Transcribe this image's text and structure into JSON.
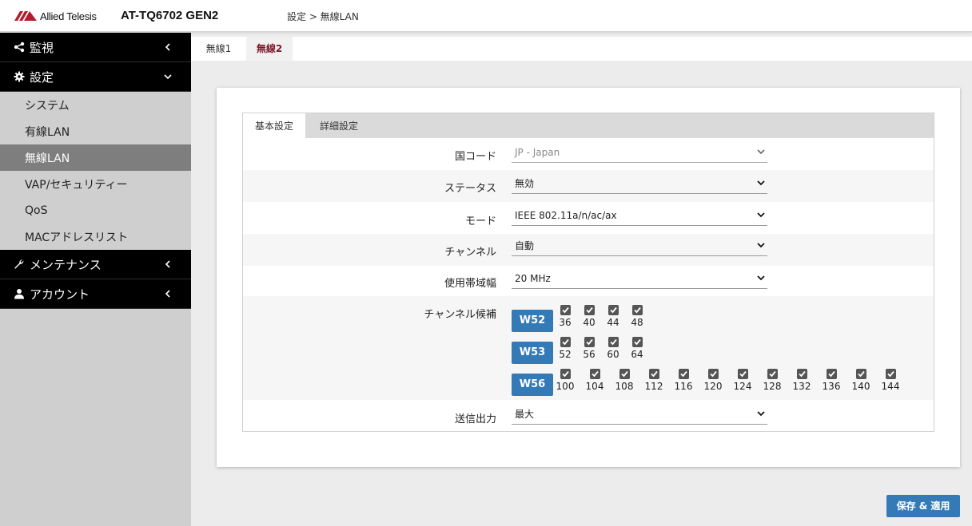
{
  "header": {
    "logo_text": "Allied Telesis",
    "model": "AT-TQ6702 GEN2",
    "breadcrumb": "設定 > 無線LAN"
  },
  "sidebar": {
    "top_items": [
      {
        "label": "監視",
        "icon": "share-icon"
      },
      {
        "label": "設定",
        "icon": "gear-icon"
      },
      {
        "label": "メンテナンス",
        "icon": "wrench-icon"
      },
      {
        "label": "アカウント",
        "icon": "user-icon"
      }
    ],
    "sub_items": [
      "システム",
      "有線LAN",
      "無線LAN",
      "VAP/セキュリティー",
      "QoS",
      "MACアドレスリスト"
    ],
    "active_sub": "無線LAN"
  },
  "radio_tabs": [
    "無線1",
    "無線2"
  ],
  "inner_tabs": [
    "基本設定",
    "詳細設定"
  ],
  "form": {
    "country_label": "国コード",
    "country_value": "JP - Japan",
    "status_label": "ステータス",
    "status_value": "無効",
    "mode_label": "モード",
    "mode_value": "IEEE 802.11a/n/ac/ax",
    "channel_label": "チャンネル",
    "channel_value": "自動",
    "bandwidth_label": "使用帯域幅",
    "bandwidth_value": "20 MHz",
    "candidates_label": "チャンネル候補",
    "power_label": "送信出力",
    "power_value": "最大"
  },
  "bands": [
    {
      "name": "W52",
      "channels": [
        "36",
        "40",
        "44",
        "48"
      ]
    },
    {
      "name": "W53",
      "channels": [
        "52",
        "56",
        "60",
        "64"
      ]
    },
    {
      "name": "W56",
      "channels": [
        "100",
        "104",
        "108",
        "112",
        "116",
        "120",
        "124",
        "128",
        "132",
        "136",
        "140",
        "144"
      ]
    }
  ],
  "save_label": "保存 & 適用",
  "colors": {
    "accent": "#337ab7",
    "active_tab": "#7b1a2b",
    "sidebar_dark": "#000000"
  }
}
